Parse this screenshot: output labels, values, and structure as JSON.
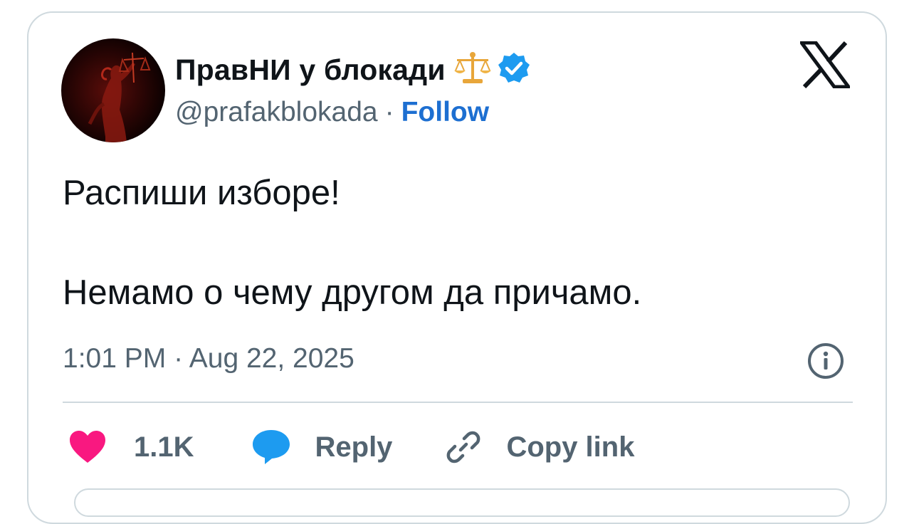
{
  "author": {
    "name": "ПравНИ у блокади",
    "handle": "@prafakblokada",
    "separator": "·",
    "follow_label": "Follow",
    "name_emoji_icon": "balance-scale-icon",
    "verified_icon": "verified-badge-icon",
    "avatar_icon": "avatar-justice-statue"
  },
  "platform": {
    "logo_icon": "x-logo-icon"
  },
  "tweet": {
    "lines": [
      "Распиши изборе!",
      "Немамо о чему другом да причамо."
    ],
    "timestamp": "1:01 PM · Aug 22, 2025",
    "info_icon": "info-icon"
  },
  "actions": {
    "like": {
      "icon": "heart-icon",
      "count": "1.1K"
    },
    "reply": {
      "icon": "speech-bubble-icon",
      "label": "Reply"
    },
    "copy": {
      "icon": "link-icon",
      "label": "Copy link"
    }
  },
  "colors": {
    "follow": "#1d6fd1",
    "verified": "#1d9bf0",
    "heart": "#f91880",
    "reply_bubble": "#1d9bf0",
    "muted_text": "#536471",
    "border": "#cfd9de"
  }
}
